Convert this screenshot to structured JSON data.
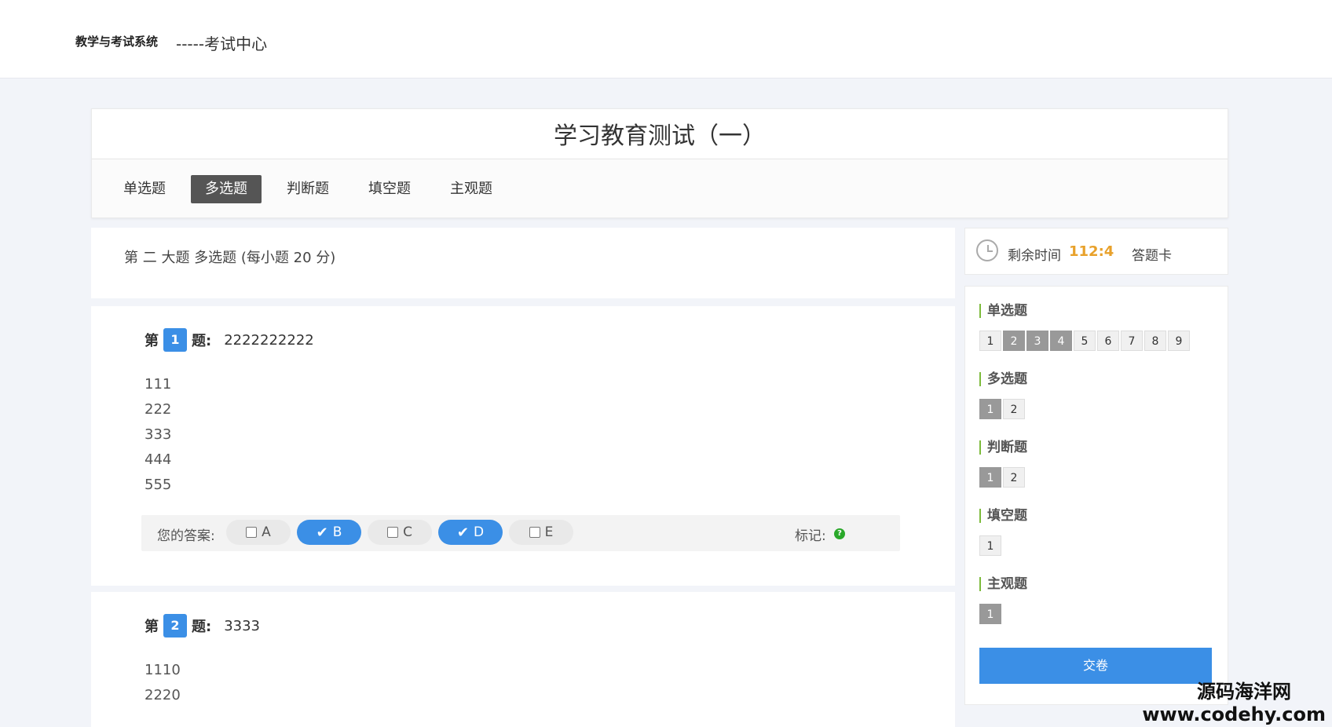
{
  "topbar": {
    "brand": "教学与考试系统",
    "subtitle": "-----考试中心"
  },
  "exam": {
    "title": "学习教育测试（一）",
    "tabs": [
      "单选题",
      "多选题",
      "判断题",
      "填空题",
      "主观题"
    ],
    "active_tab": "多选题"
  },
  "section": {
    "heading": "第 二 大题 多选题 (每小题 20 分)"
  },
  "questions": [
    {
      "prefix": "第",
      "number": "1",
      "suffix": "题:",
      "text": "2222222222",
      "options": [
        "111",
        "222",
        "333",
        "444",
        "555"
      ],
      "answer_label": "您的答案:",
      "choices": [
        {
          "letter": "A",
          "checked": false
        },
        {
          "letter": "B",
          "checked": true
        },
        {
          "letter": "C",
          "checked": false
        },
        {
          "letter": "D",
          "checked": true
        },
        {
          "letter": "E",
          "checked": false
        }
      ],
      "mark_label": "标记:"
    },
    {
      "prefix": "第",
      "number": "2",
      "suffix": "题:",
      "text": "3333",
      "options": [
        "1110",
        "2220"
      ]
    }
  ],
  "timer": {
    "label": "剩余时间",
    "value": "112:4",
    "card_label": "答题卡"
  },
  "answer_card": {
    "groups": [
      {
        "title": "单选题",
        "cells": [
          "1",
          "2",
          "3",
          "4",
          "5",
          "6",
          "7",
          "8",
          "9"
        ],
        "filled": [
          2,
          3,
          4
        ]
      },
      {
        "title": "多选题",
        "cells": [
          "1",
          "2"
        ],
        "filled": [
          1
        ]
      },
      {
        "title": "判断题",
        "cells": [
          "1",
          "2"
        ],
        "filled": [
          1
        ]
      },
      {
        "title": "填空题",
        "cells": [
          "1"
        ],
        "filled": []
      },
      {
        "title": "主观题",
        "cells": [
          "1"
        ],
        "filled": [
          1
        ]
      }
    ],
    "submit_label": "交卷"
  },
  "watermark": {
    "line1": "源码海洋网",
    "line2": "www.codehy.com"
  },
  "colors": {
    "accent": "#3b8fe6",
    "timer": "#e8a12b",
    "tab_active": "#555555"
  }
}
